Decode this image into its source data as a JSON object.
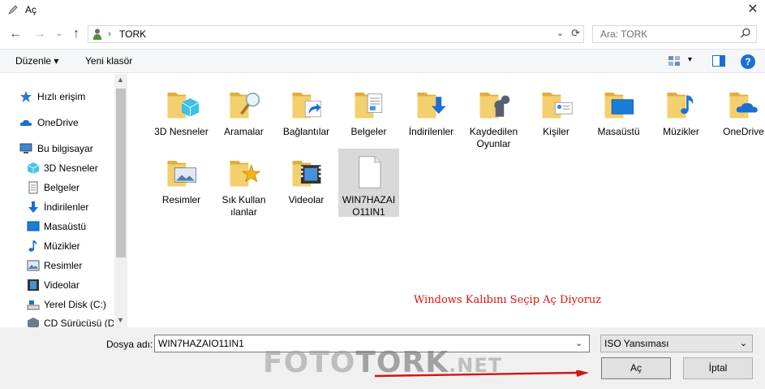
{
  "window": {
    "title": "Aç",
    "close_glyph": "✕"
  },
  "address": {
    "crumb": "TORK",
    "separator": "›",
    "search_placeholder": "Ara: TORK"
  },
  "toolbar": {
    "organize": "Düzenle",
    "new_folder": "Yeni klasör",
    "help": "?"
  },
  "sidebar": {
    "items": [
      {
        "label": "Hızlı erişim",
        "icon": "star-icon"
      },
      {
        "label": "OneDrive",
        "icon": "cloud-icon"
      },
      {
        "label": "Bu bilgisayar",
        "icon": "computer-icon"
      },
      {
        "label": "3D Nesneler",
        "icon": "cube-icon"
      },
      {
        "label": "Belgeler",
        "icon": "document-icon"
      },
      {
        "label": "İndirilenler",
        "icon": "download-icon"
      },
      {
        "label": "Masaüstü",
        "icon": "desktop-icon"
      },
      {
        "label": "Müzikler",
        "icon": "music-icon"
      },
      {
        "label": "Resimler",
        "icon": "picture-icon"
      },
      {
        "label": "Videolar",
        "icon": "video-icon"
      },
      {
        "label": "Yerel Disk (C:)",
        "icon": "drive-icon"
      },
      {
        "label": "CD Sürücüsü (D:",
        "icon": "cd-icon"
      }
    ]
  },
  "files": [
    {
      "label": "3D Nesneler",
      "icon": "folder-3d-icon"
    },
    {
      "label": "Aramalar",
      "icon": "folder-search-icon"
    },
    {
      "label": "Bağlantılar",
      "icon": "folder-links-icon"
    },
    {
      "label": "Belgeler",
      "icon": "folder-documents-icon"
    },
    {
      "label": "İndirilenler",
      "icon": "folder-downloads-icon"
    },
    {
      "label": "Kaydedilen Oyunlar",
      "icon": "folder-games-icon"
    },
    {
      "label": "Kişiler",
      "icon": "folder-contacts-icon"
    },
    {
      "label": "Masaüstü",
      "icon": "folder-desktop-icon"
    },
    {
      "label": "Müzikler",
      "icon": "folder-music-icon"
    },
    {
      "label": "OneDrive",
      "icon": "folder-onedrive-icon"
    },
    {
      "label": "Resimler",
      "icon": "folder-pictures-icon"
    },
    {
      "label": "Sık Kullanılanlar",
      "icon": "folder-favorites-icon"
    },
    {
      "label": "Videolar",
      "icon": "folder-videos-icon"
    },
    {
      "label": "WIN7HAZAIO11IN1",
      "icon": "file-icon",
      "selected": true
    }
  ],
  "annotation": "Windows Kalıbını Seçip Aç Diyoruz",
  "footer": {
    "filename_label": "Dosya adı:",
    "filename_value": "WIN7HAZAIO11IN1",
    "filetype": "ISO Yansıması",
    "open_button": "Aç",
    "cancel_button": "İptal"
  },
  "watermark": "FOTOTORK.NET",
  "colors": {
    "annotation": "#e01010",
    "folder": "#f0c75e",
    "accent": "#1a6fd4"
  }
}
